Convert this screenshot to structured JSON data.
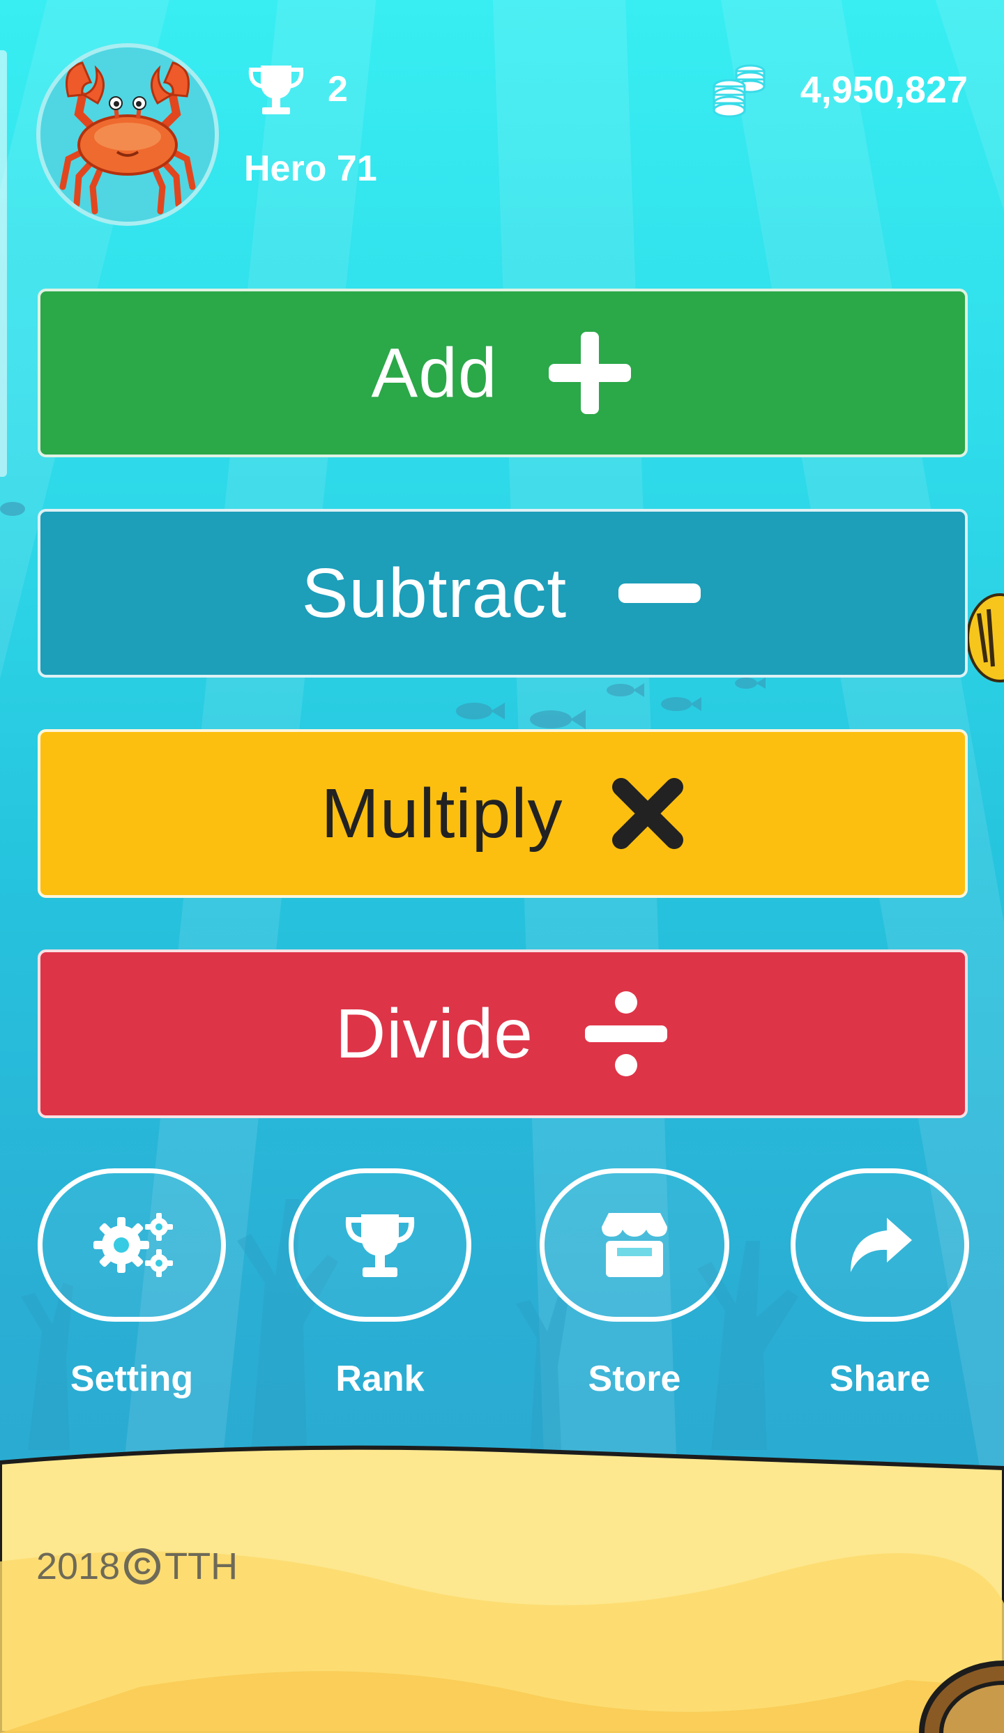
{
  "player": {
    "avatar_icon": "crab-icon",
    "trophies": "2",
    "name": "Hero 71",
    "coins": "4,950,827"
  },
  "operations": [
    {
      "label": "Add",
      "icon": "plus-icon",
      "color": "#2ba848"
    },
    {
      "label": "Subtract",
      "icon": "minus-icon",
      "color": "#1d9eb9"
    },
    {
      "label": "Multiply",
      "icon": "multiply-icon",
      "color": "#fdbf0f"
    },
    {
      "label": "Divide",
      "icon": "divide-icon",
      "color": "#de3448"
    }
  ],
  "menu": [
    {
      "label": "Setting",
      "icon": "gears-icon"
    },
    {
      "label": "Rank",
      "icon": "trophy-icon"
    },
    {
      "label": "Store",
      "icon": "store-icon"
    },
    {
      "label": "Share",
      "icon": "share-icon"
    }
  ],
  "footer": {
    "year": "2018",
    "owner": "TTH"
  }
}
